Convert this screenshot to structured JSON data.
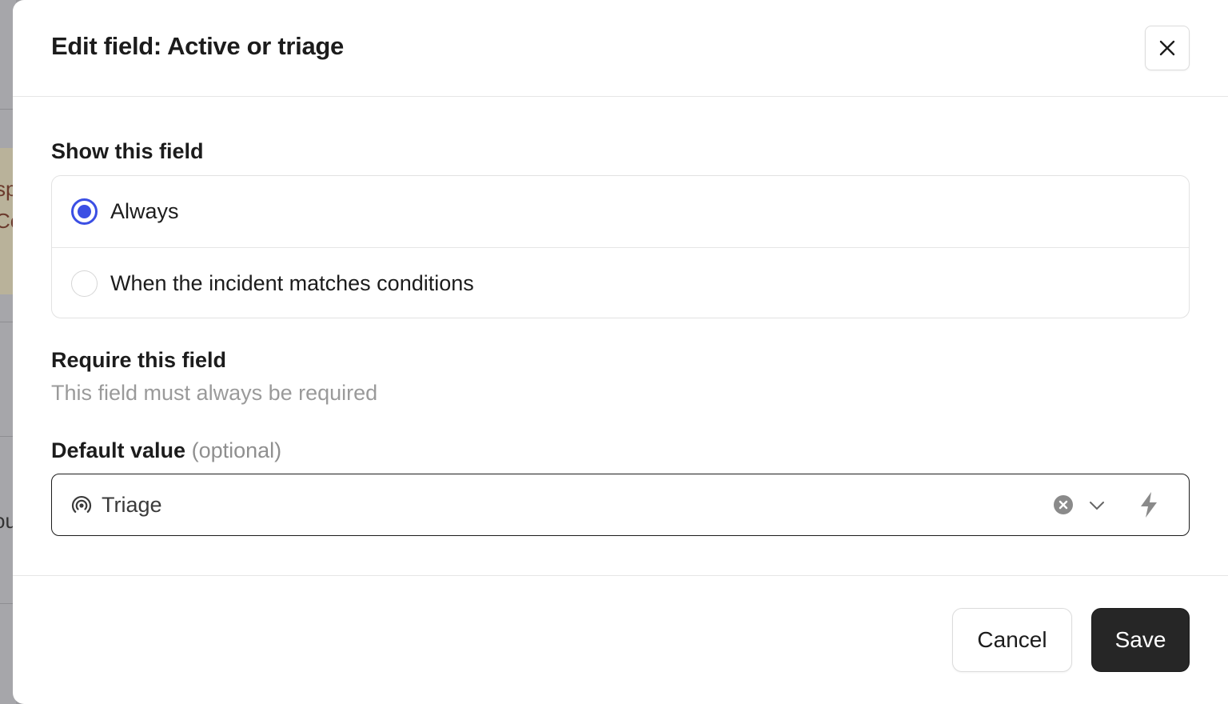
{
  "background": {
    "card_text_1": "sp",
    "card_text_2": "Co",
    "row_text": "ou"
  },
  "modal": {
    "title": "Edit field: Active or triage",
    "close_icon": "x-icon"
  },
  "show_field": {
    "label": "Show this field",
    "options": [
      {
        "label": "Always",
        "checked": true
      },
      {
        "label": "When the incident matches conditions",
        "checked": false
      }
    ]
  },
  "require_field": {
    "label": "Require this field",
    "helper": "This field must always be required"
  },
  "default_value": {
    "label": "Default value",
    "optional": "(optional)",
    "value": "Triage",
    "icons": [
      "broadcast-icon",
      "clear-icon",
      "chevron-down-icon",
      "lightning-icon"
    ]
  },
  "footer": {
    "cancel_label": "Cancel",
    "save_label": "Save"
  },
  "colors": {
    "accent": "#3b4fe4",
    "primary_button": "#262626"
  }
}
